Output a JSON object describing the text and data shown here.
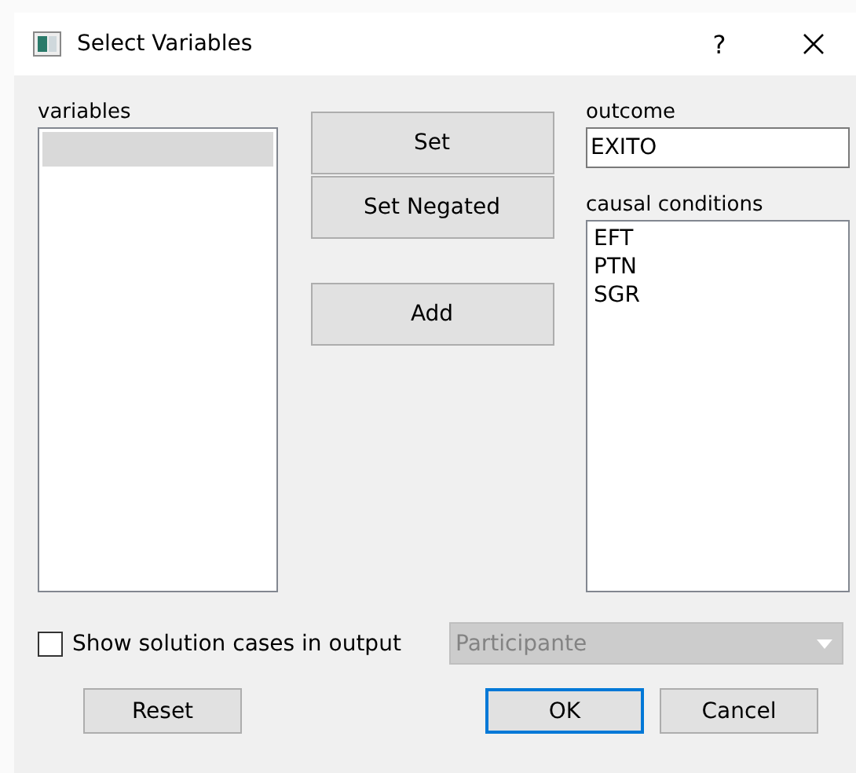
{
  "window": {
    "title": "Select Variables",
    "help": "?"
  },
  "variables": {
    "label": "variables"
  },
  "actions": [
    {
      "label": "Set"
    },
    {
      "label": "Set Negated"
    },
    {
      "label": "Add"
    }
  ],
  "outcome": {
    "label": "outcome",
    "value": "EXITO"
  },
  "causal_conditions": {
    "label": "causal conditions",
    "items": [
      "EFT",
      "PTN",
      "SGR"
    ]
  },
  "show_cases": {
    "label": "Show solution cases in output",
    "checked": false
  },
  "case_column": {
    "value": "Participante",
    "disabled": true
  },
  "buttons": [
    {
      "label": "Reset",
      "default": false
    },
    {
      "label": "OK",
      "default": true
    },
    {
      "label": "Cancel",
      "default": false
    }
  ]
}
